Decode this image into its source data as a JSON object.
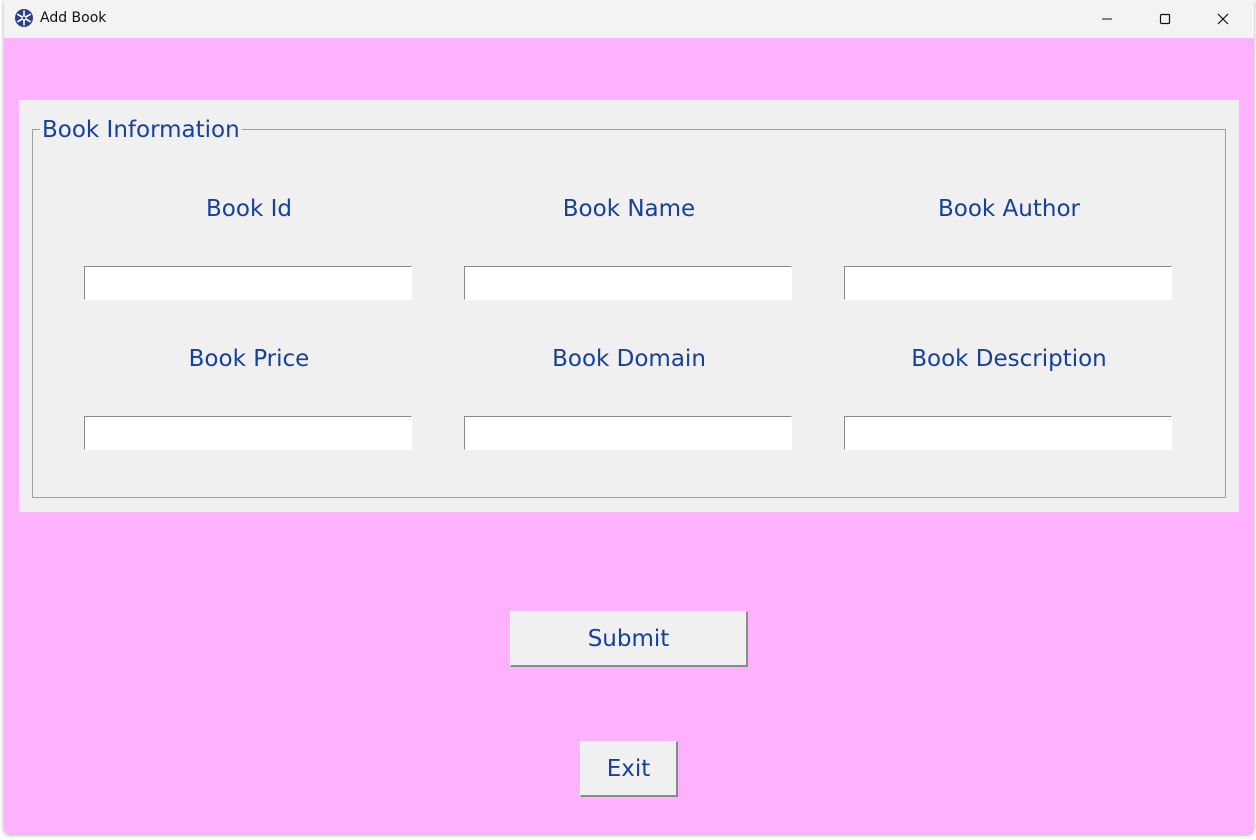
{
  "window": {
    "title": "Add Book",
    "background_color": "#ffb3ff",
    "icons": {
      "app": "snowflake-app-icon",
      "minimize": "minimize-icon",
      "maximize": "maximize-icon",
      "close": "close-icon"
    }
  },
  "form": {
    "group_title": "Book Information",
    "text_color": "#1640a0",
    "fields": [
      {
        "label": "Book Id",
        "value": "",
        "placeholder": ""
      },
      {
        "label": "Book Name",
        "value": "",
        "placeholder": ""
      },
      {
        "label": "Book Author",
        "value": "",
        "placeholder": ""
      },
      {
        "label": "Book Price",
        "value": "",
        "placeholder": ""
      },
      {
        "label": "Book Domain",
        "value": "",
        "placeholder": ""
      },
      {
        "label": "Book Description",
        "value": "",
        "placeholder": ""
      }
    ]
  },
  "buttons": {
    "submit_label": "Submit",
    "exit_label": "Exit"
  }
}
